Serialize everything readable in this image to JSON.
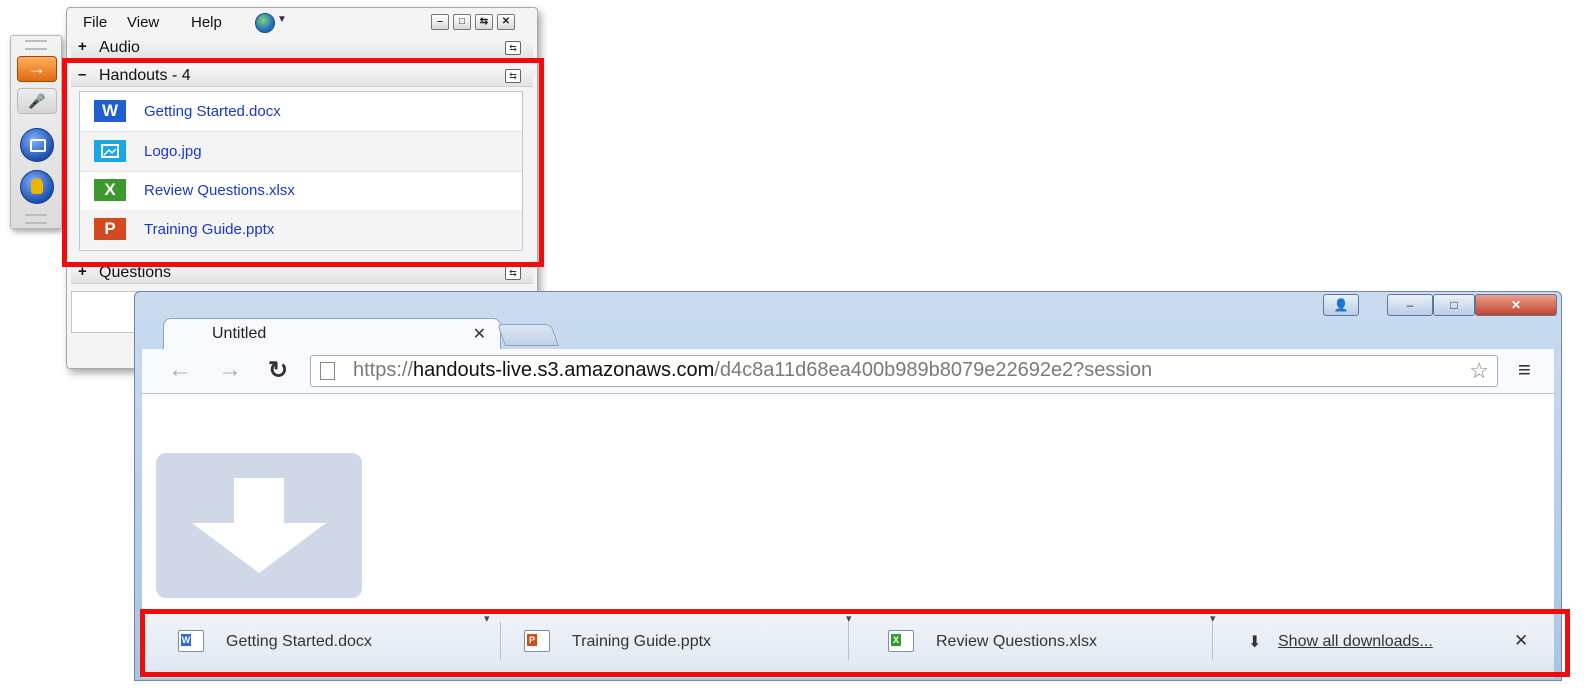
{
  "panel": {
    "menu": [
      "File",
      "View",
      "Help"
    ],
    "sections": {
      "audio": {
        "sign": "+",
        "label": "Audio"
      },
      "handouts": {
        "sign": "–",
        "label": "Handouts - 4"
      },
      "questions": {
        "sign": "+",
        "label": "Questions"
      }
    },
    "handouts": [
      {
        "icon_letter": "W",
        "icon": "word-icon",
        "color": "#1f5fcf",
        "name": "Getting Started.docx"
      },
      {
        "icon_letter": "",
        "icon": "image-icon",
        "color": "#19a8e8",
        "name": "Logo.jpg"
      },
      {
        "icon_letter": "X",
        "icon": "excel-icon",
        "color": "#3b9a2c",
        "name": "Review Questions.xlsx"
      },
      {
        "icon_letter": "P",
        "icon": "powerpoint-icon",
        "color": "#d24a1e",
        "name": "Training Guide.pptx"
      }
    ]
  },
  "browser": {
    "tab_title": "Untitled",
    "url": {
      "scheme": "https://",
      "host": "handouts-live.s3.amazonaws.com",
      "path": "/d4c8a11d68ea400b989b8079e22692e2?session"
    },
    "downloads": [
      {
        "name": "Getting Started.docx",
        "icon": "word-doc-icon",
        "color": "#2f6bd0"
      },
      {
        "name": "Training Guide.pptx",
        "icon": "powerpoint-doc-icon",
        "color": "#d24a1e"
      },
      {
        "name": "Review Questions.xlsx",
        "icon": "excel-doc-icon",
        "color": "#3b9a2c"
      }
    ],
    "show_all": "Show all downloads..."
  },
  "colors": {
    "highlight": "#ee0c0c",
    "link": "#1a38c8"
  }
}
